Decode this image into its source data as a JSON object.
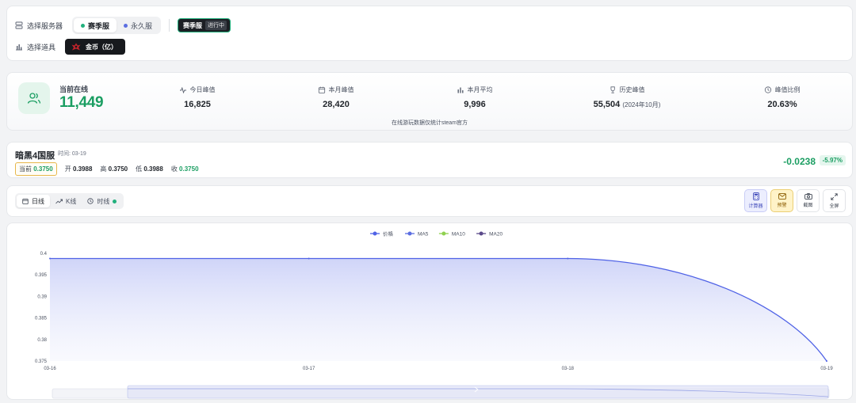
{
  "server": {
    "label": "选择服务器",
    "options": [
      "赛季服",
      "永久服"
    ],
    "selected": "赛季服",
    "badge_name": "赛季服",
    "badge_status": "进行中"
  },
  "item": {
    "label": "选择道具",
    "selected": "金币（亿）"
  },
  "stats": {
    "online_label": "当前在线",
    "online_value": "11,449",
    "items": [
      {
        "label": "今日峰值",
        "value": "16,825",
        "note": "",
        "icon": "pulse-icon"
      },
      {
        "label": "本月峰值",
        "value": "28,420",
        "note": "",
        "icon": "calendar-icon"
      },
      {
        "label": "本月平均",
        "value": "9,996",
        "note": "",
        "icon": "bar-chart-icon"
      },
      {
        "label": "历史峰值",
        "value": "55,504",
        "note": "(2024年10月)",
        "icon": "trophy-icon"
      },
      {
        "label": "峰值比例",
        "value": "20.63%",
        "note": "",
        "icon": "clock-icon"
      }
    ],
    "footer": "在线游玩数据仅统计steam官方"
  },
  "market": {
    "title": "暗黑4国服",
    "time_label": "时间: 03-19",
    "current_label": "当前",
    "current_value": "0.3750",
    "open_label": "开",
    "open_value": "0.3988",
    "high_label": "高",
    "high_value": "0.3750",
    "low_label": "低",
    "low_value": "0.3988",
    "close_label": "收",
    "close_value": "0.3750",
    "change": "-0.0238",
    "change_pct": "-5.97%"
  },
  "toolbar": {
    "tabs": [
      "日线",
      "K线",
      "时线"
    ],
    "active_tab": "日线",
    "tools": [
      "计算器",
      "预警",
      "截图",
      "全屏"
    ]
  },
  "colors": {
    "accent_green": "#1b9e62",
    "series_price": "#4f62e6",
    "series_ma5": "#5b6ee1",
    "series_ma10": "#8fd14f",
    "series_ma20": "#5b4a8a",
    "alert_yellow": "#fff3c8"
  },
  "chart_data": {
    "type": "line",
    "x": [
      "03-16",
      "03-17",
      "03-18",
      "03-19"
    ],
    "series": [
      {
        "name": "价格",
        "values": [
          0.3988,
          0.3988,
          0.3988,
          0.375
        ]
      },
      {
        "name": "MA5",
        "values": []
      },
      {
        "name": "MA10",
        "values": []
      },
      {
        "name": "MA20",
        "values": []
      }
    ],
    "yticks": [
      "0.4",
      "0.395",
      "0.39",
      "0.385",
      "0.38",
      "0.375"
    ],
    "ylim": [
      0.375,
      0.4
    ],
    "legend": "top-center",
    "area_fill": true,
    "grid": false
  }
}
